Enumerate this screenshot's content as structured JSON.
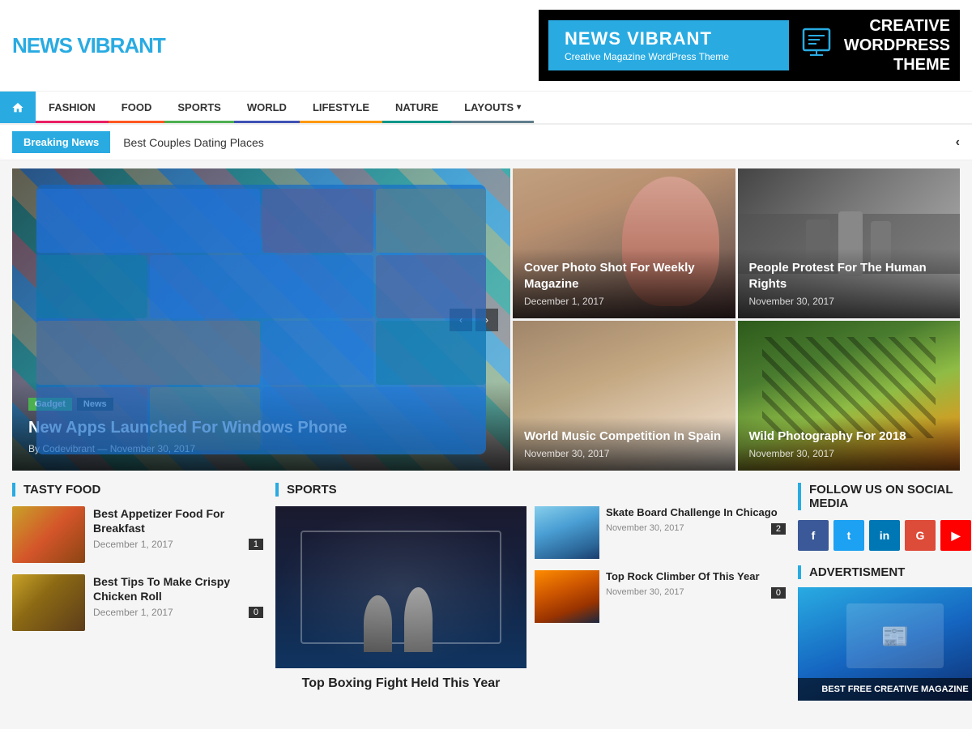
{
  "header": {
    "logo_news": "NEWS",
    "logo_vibrant": "VIBRANT",
    "ad_main": "NEWS VIBRANT",
    "ad_sub": "Creative Magazine WordPress Theme",
    "ad_right_line1": "CREATIVE",
    "ad_right_line2": "WORDPRESS",
    "ad_right_line3": "THEME"
  },
  "nav": {
    "home_label": "Home",
    "items": [
      {
        "label": "FASHION",
        "color": "#e91e63"
      },
      {
        "label": "FOOD",
        "color": "#ff5722"
      },
      {
        "label": "SPORTS",
        "color": "#4caf50"
      },
      {
        "label": "WORLD",
        "color": "#3f51b5"
      },
      {
        "label": "LIFESTYLE",
        "color": "#ff9800"
      },
      {
        "label": "NATURE",
        "color": "#009688"
      },
      {
        "label": "LAYOUTS",
        "color": "#607d8b",
        "dropdown": true
      }
    ]
  },
  "breaking_news": {
    "label": "Breaking News",
    "text": "Best Couples Dating Places"
  },
  "featured": {
    "main": {
      "tags": [
        "Gadget",
        "News"
      ],
      "title": "New Apps Launched For Windows Phone",
      "author": "By Codevibrant",
      "date": "November 30, 2017"
    },
    "top_right": {
      "title": "Cover Photo Shot For Weekly Magazine",
      "date": "December 1, 2017"
    },
    "top_right2": {
      "title": "People Protest For The Human Rights",
      "date": "November 30, 2017"
    },
    "bottom_right": {
      "title": "World Music Competition In Spain",
      "date": "November 30, 2017"
    },
    "bottom_right2": {
      "title": "Wild Photography For 2018",
      "date": "November 30, 2017"
    }
  },
  "tasty_food": {
    "section_title": "TASTY FOOD",
    "items": [
      {
        "title": "Best Appetizer Food For Breakfast",
        "date": "December 1, 2017",
        "count": "1"
      },
      {
        "title": "Best Tips To Make Crispy Chicken Roll",
        "date": "December 1, 2017",
        "count": "0"
      }
    ]
  },
  "sports": {
    "section_title": "SPORTS",
    "main_title": "Top Boxing Fight Held This Year",
    "side_items": [
      {
        "title": "Skate Board Challenge In Chicago",
        "date": "November 30, 2017",
        "count": "2"
      },
      {
        "title": "Top Rock Climber Of This Year",
        "date": "November 30, 2017",
        "count": "0"
      }
    ]
  },
  "social": {
    "section_title": "FOLLOW US ON SOCIAL MEDIA",
    "buttons": [
      "f",
      "t",
      "in",
      "G",
      "▶"
    ],
    "advert_title": "ADVERTISMENT",
    "advert_text": "BEST FREE CREATIVE MAGAZINE"
  },
  "colors": {
    "accent": "#29abe2",
    "dark": "#222",
    "text_muted": "#888"
  }
}
